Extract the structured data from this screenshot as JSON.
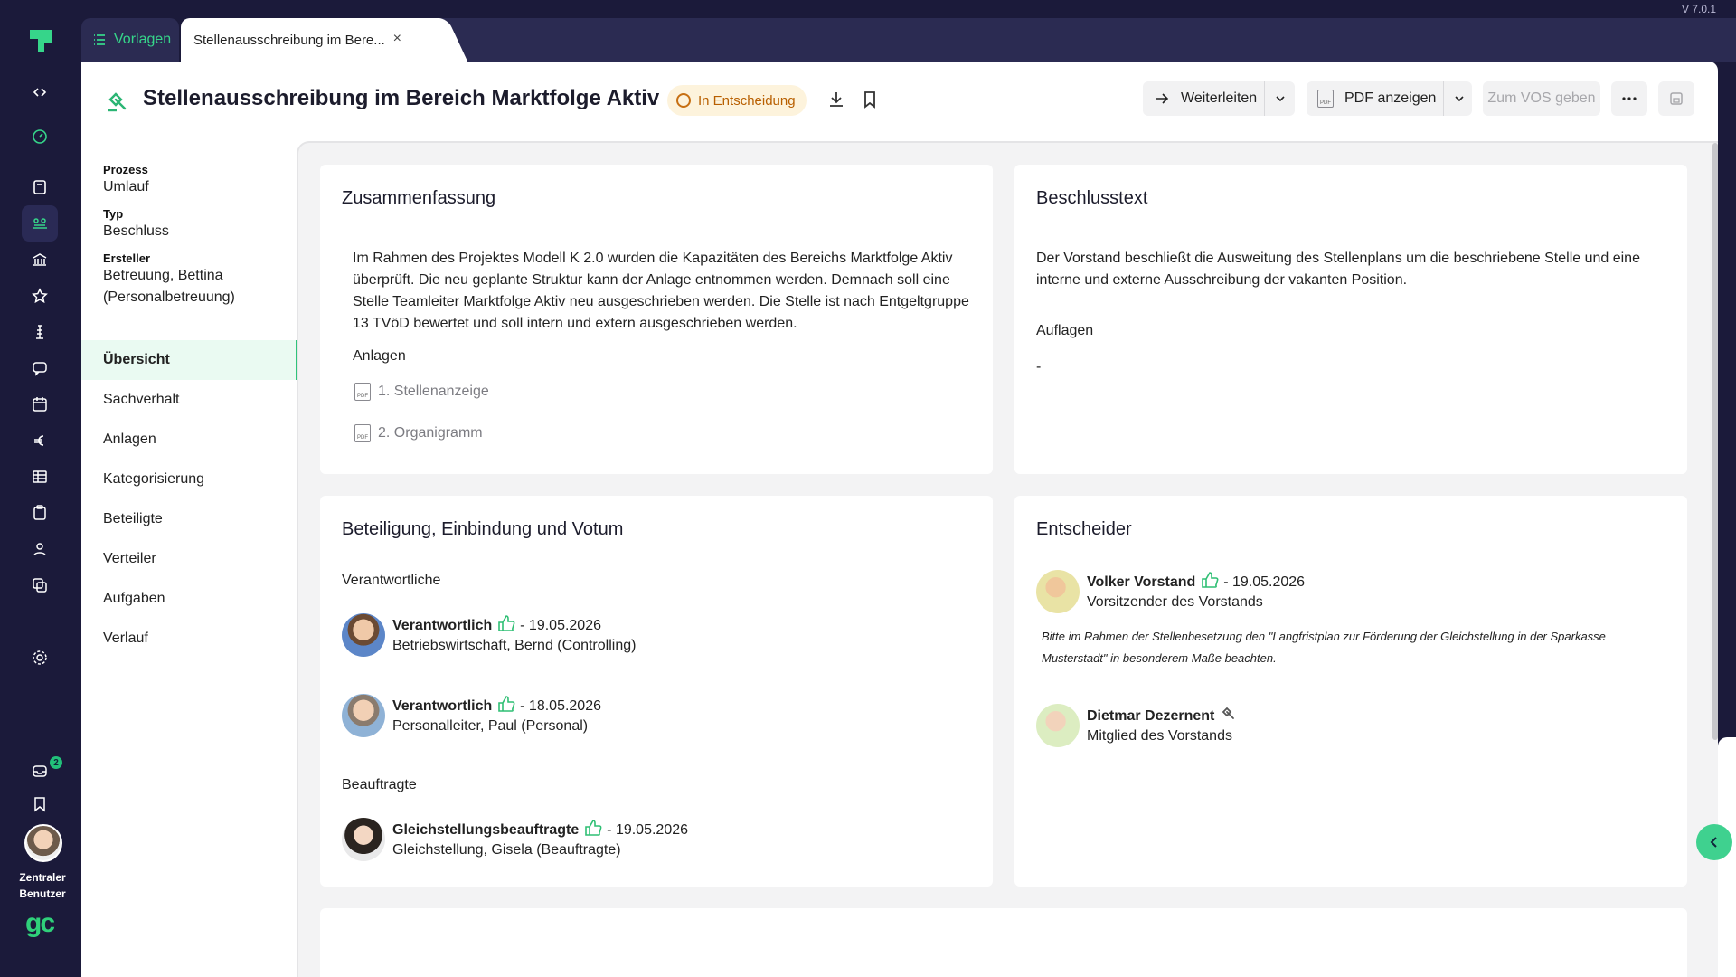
{
  "app": {
    "version": "V 7.0.1",
    "user": "Zentraler Benutzer",
    "inbox_count": "2"
  },
  "tabs": {
    "templates_label": "Vorlagen",
    "active_label": "Stellenausschreibung im Bere...",
    "close": "×"
  },
  "header": {
    "title": "Stellenausschreibung im Bereich Marktfolge Aktiv",
    "status": "In Entscheidung",
    "forward_label": "Weiterleiten",
    "pdf_label": "PDF anzeigen",
    "vos_label": "Zum VOS geben"
  },
  "meta": {
    "process_label": "Prozess",
    "process_value": "Umlauf",
    "type_label": "Typ",
    "type_value": "Beschluss",
    "creator_label": "Ersteller",
    "creator_value": "Betreuung, Bettina",
    "creator_value2": "(Personalbetreuung)"
  },
  "nav": [
    "Übersicht",
    "Sachverhalt",
    "Anlagen",
    "Kategorisierung",
    "Beteiligte",
    "Verteiler",
    "Aufgaben",
    "Verlauf"
  ],
  "summary": {
    "title": "Zusammenfassung",
    "text": "Im Rahmen des Projektes Modell K 2.0 wurden die Kapazitäten des Bereichs Marktfolge Aktiv überprüft. Die neu geplante Struktur kann der Anlage entnommen werden. Demnach soll eine Stelle Teamleiter Marktfolge Aktiv neu ausgeschrieben werden. Die Stelle ist nach Entgeltgruppe 13 TVöD bewertet und soll intern und extern ausgeschrieben werden.",
    "attachments_label": "Anlagen",
    "attachments": [
      "1. Stellenanzeige",
      "2. Organigramm"
    ]
  },
  "resolution": {
    "title": "Beschlusstext",
    "text": "Der Vorstand beschließt die Ausweitung des Stellenplans um die beschriebene Stelle und eine interne und externe Ausschreibung der vakanten Position.",
    "conditions_label": "Auflagen",
    "conditions_value": "-"
  },
  "participation": {
    "title": "Beteiligung, Einbindung und Votum",
    "responsible_label": "Verantwortliche",
    "commissioners_label": "Beauftragte",
    "people": [
      {
        "role": "Verantwortlich",
        "date": " - 19.05.2026",
        "detail": "Betriebswirtschaft, Bernd (Controlling)"
      },
      {
        "role": "Verantwortlich",
        "date": " - 18.05.2026",
        "detail": "Personalleiter, Paul (Personal)"
      },
      {
        "role": "Gleichstellungsbeauftragte",
        "date": " - 19.05.2026",
        "detail": "Gleichstellung, Gisela (Beauftragte)"
      }
    ]
  },
  "deciders": {
    "title": "Entscheider",
    "people": [
      {
        "name": "Volker Vorstand",
        "date": " - 19.05.2026",
        "detail": "Vorsitzender des Vorstands"
      },
      {
        "name": "Dietmar Dezernent",
        "detail": "Mitglied des Vorstands"
      }
    ],
    "note": "Bitte im Rahmen der Stellenbesetzung den \"Langfristplan zur Förderung der Gleichstellung in der Sparkasse Musterstadt\" in besonderem Maße beachten."
  },
  "colors": {
    "accent": "#2fc37a",
    "sidebar": "#1b1a3a",
    "status_bg": "#fdf3dc",
    "status_fg": "#b85f00"
  }
}
